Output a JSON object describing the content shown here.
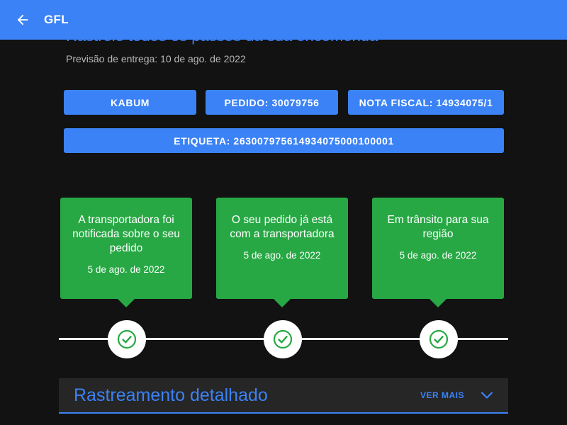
{
  "app": {
    "title": "GFL"
  },
  "header": {
    "heading": "Rastreie todos os passos da sua encomenda",
    "delivery_estimate": "Previsão de entrega: 10 de ago. de 2022"
  },
  "chips": {
    "store": "KABUM",
    "order": "PEDIDO: 30079756",
    "invoice": "NOTA FISCAL: 14934075/1",
    "label": "ETIQUETA: 263007975614934075000100001"
  },
  "timeline": [
    {
      "title": "A transportadora foi notificada sobre o seu pedido",
      "date": "5 de ago. de 2022"
    },
    {
      "title": "O seu pedido já está com a transportadora",
      "date": "5 de ago. de 2022"
    },
    {
      "title": "Em trânsito para sua região",
      "date": "5 de ago. de 2022"
    }
  ],
  "details": {
    "title": "Rastreamento detalhado",
    "see_more": "VER MAIS"
  },
  "colors": {
    "primary": "#3b82f6",
    "success": "#27a844",
    "background": "#121212",
    "panel": "#262626"
  },
  "icons": {
    "back": "arrow-left-icon",
    "check": "check-circle-icon",
    "expand": "chevron-down-icon"
  }
}
